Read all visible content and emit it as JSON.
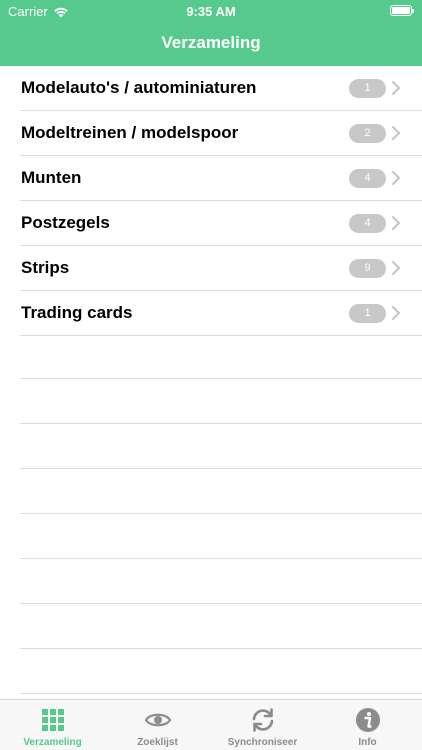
{
  "status_bar": {
    "carrier": "Carrier",
    "time": "9:35 AM"
  },
  "nav": {
    "title": "Verzameling"
  },
  "list": [
    {
      "label": "Modelauto's / autominiaturen",
      "count": "1"
    },
    {
      "label": "Modeltreinen / modelspoor",
      "count": "2"
    },
    {
      "label": "Munten",
      "count": "4"
    },
    {
      "label": "Postzegels",
      "count": "4"
    },
    {
      "label": "Strips",
      "count": "9"
    },
    {
      "label": "Trading cards",
      "count": "1"
    }
  ],
  "tabs": [
    {
      "label": "Verzameling",
      "icon": "grid-icon",
      "active": true
    },
    {
      "label": "Zoeklijst",
      "icon": "eye-icon",
      "active": false
    },
    {
      "label": "Synchroniseer",
      "icon": "sync-icon",
      "active": false
    },
    {
      "label": "Info",
      "icon": "info-icon",
      "active": false
    }
  ],
  "colors": {
    "accent": "#56c98c",
    "badge": "#c8c8c8",
    "inactive": "#8c8c8c"
  }
}
